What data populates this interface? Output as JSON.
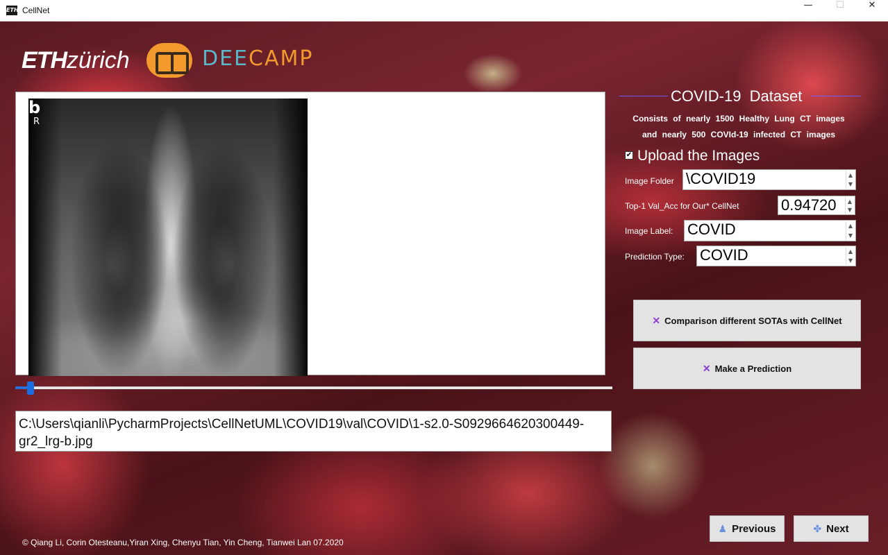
{
  "window": {
    "title": "CellNet",
    "icon_text": "ETH",
    "minimize": "—",
    "maximize": "☐",
    "close": "✕"
  },
  "logos": {
    "eth_bold": "ETH",
    "eth_light": "zürich",
    "deecamp_part1": "DEE",
    "deecamp_part2": "CAMP"
  },
  "image_panel": {
    "label_letter": "b",
    "label_side": "R"
  },
  "slider": {
    "value_fraction": 0.02
  },
  "path": {
    "value": "C:\\Users\\qianli\\PycharmProjects\\CellNetUML\\COVID19\\val\\COVID\\1-s2.0-S0929664620300449-gr2_lrg-b.jpg"
  },
  "dataset": {
    "title": "COVID-19 Dataset",
    "line1": "Consists of nearly 1500  Healthy  Lung CT  images",
    "line2": "and  nearly  500  COVId-19  infected  CT  images"
  },
  "upload": {
    "checked": true,
    "check_glyph": "✔",
    "label": "Upload the Images"
  },
  "fields": {
    "image_folder": {
      "label": "Image Folder",
      "value": "\\COVID19"
    },
    "top1_acc": {
      "label": "Top-1 Val_Acc for Our* CellNet",
      "value": "0.94720"
    },
    "image_label": {
      "label": "Image Label:",
      "value": "COVID"
    },
    "prediction_type": {
      "label": "Prediction Type:",
      "value": "COVID"
    }
  },
  "spin_up": "▲",
  "spin_down": "▼",
  "buttons": {
    "comparison": "Comparison different SOTAs with CellNet",
    "predict": "Make a Prediction",
    "x_glyph": "✕",
    "previous": "Previous",
    "next": "Next",
    "previous_icon": "person-icon",
    "next_icon": "crosshair-icon"
  },
  "footer": {
    "credits": "© Qiang Li, Corin Otesteanu,Yiran Xing, Chenyu Tian, Yin Cheng, Tianwei Lan 07.2020"
  },
  "colors": {
    "accent_blue": "#1a6ee0",
    "title_line": "#6a5cff",
    "x_purple": "#8a3fd0",
    "deecamp_orange": "#f29a2e",
    "deecamp_teal": "#59b8c8"
  }
}
